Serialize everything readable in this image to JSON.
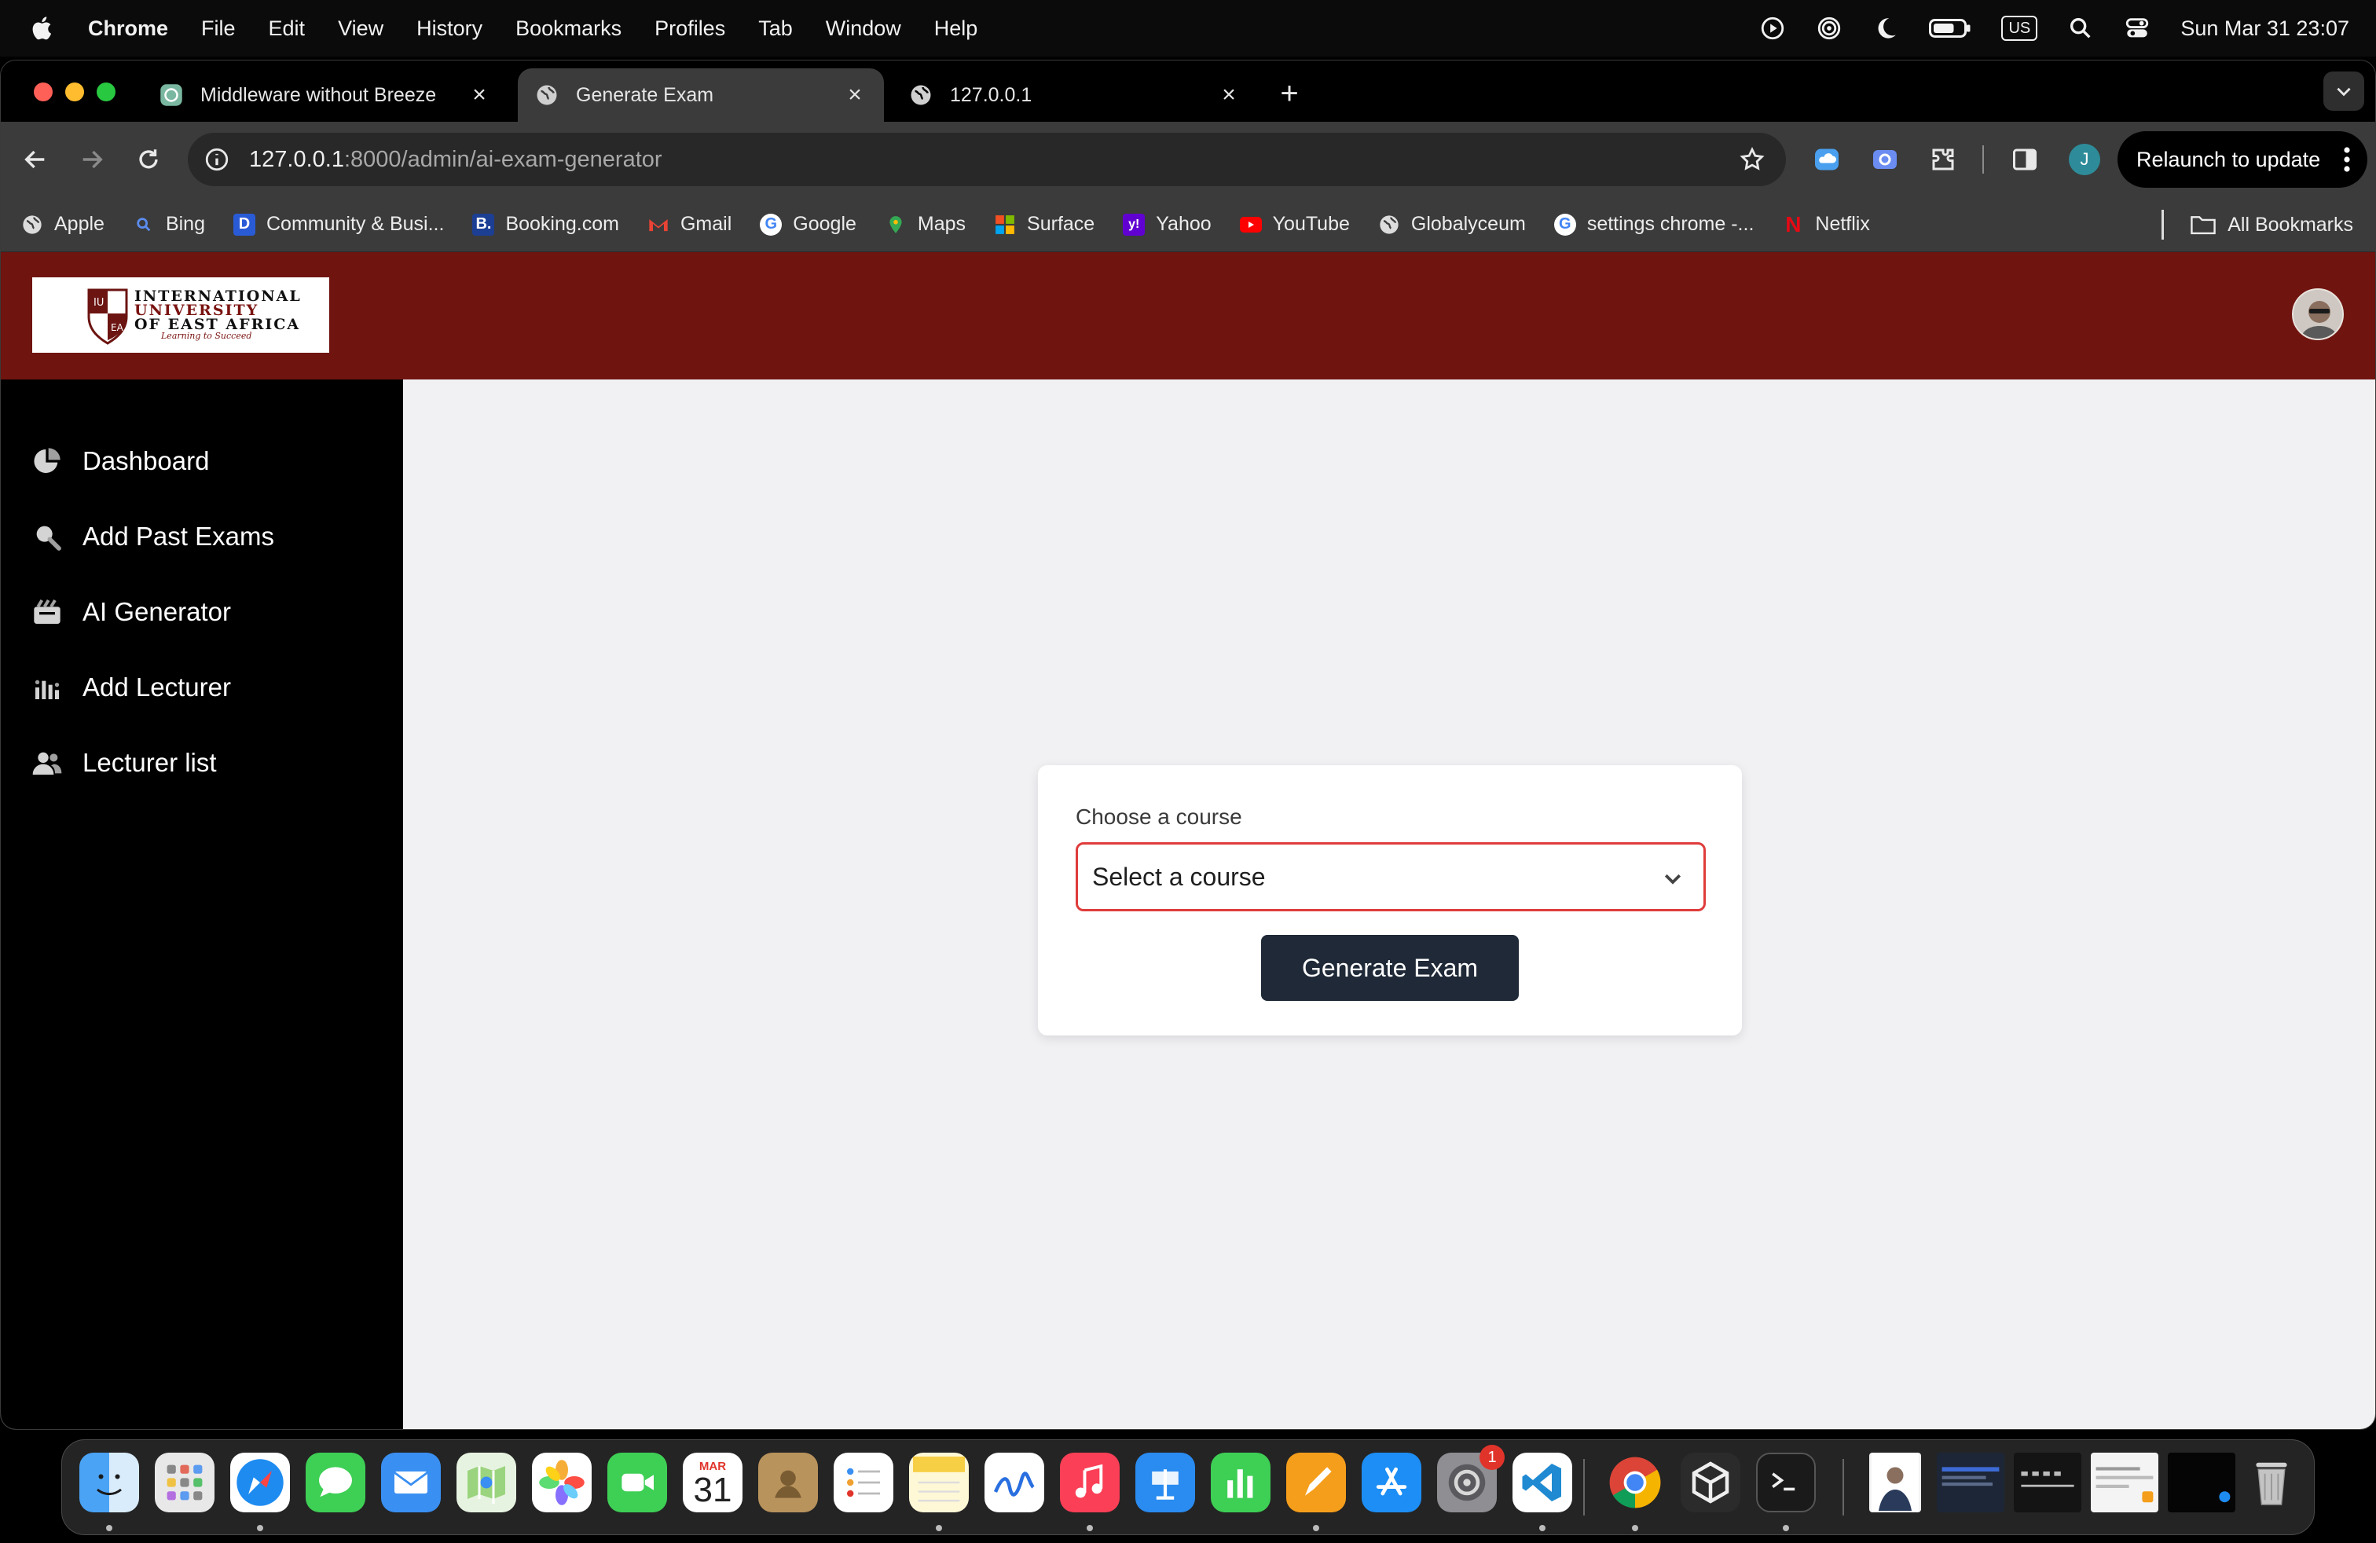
{
  "menubar": {
    "app": "Chrome",
    "items": [
      "File",
      "Edit",
      "View",
      "History",
      "Bookmarks",
      "Profiles",
      "Tab",
      "Window",
      "Help"
    ],
    "keyboard": "US",
    "datetime": "Sun Mar 31  23:07"
  },
  "tabs": [
    {
      "title": "Middleware without Breeze",
      "active": false
    },
    {
      "title": "Generate Exam",
      "active": true
    },
    {
      "title": "127.0.0.1",
      "active": false
    }
  ],
  "omnibox": {
    "host": "127.0.0.1",
    "path": ":8000/admin/ai-exam-generator"
  },
  "profile_initial": "J",
  "relaunch_label": "Relaunch to update",
  "bookmarks": [
    {
      "label": "Apple",
      "icon": "globe-icon"
    },
    {
      "label": "Bing",
      "icon": "search-icon"
    },
    {
      "label": "Community & Busi...",
      "icon": "community-icon"
    },
    {
      "label": "Booking.com",
      "icon": "booking-icon"
    },
    {
      "label": "Gmail",
      "icon": "gmail-icon"
    },
    {
      "label": "Google",
      "icon": "google-icon"
    },
    {
      "label": "Maps",
      "icon": "maps-icon"
    },
    {
      "label": "Surface",
      "icon": "microsoft-icon"
    },
    {
      "label": "Yahoo",
      "icon": "yahoo-icon"
    },
    {
      "label": "YouTube",
      "icon": "youtube-icon"
    },
    {
      "label": "Globalyceum",
      "icon": "globe-icon"
    },
    {
      "label": "settings chrome -...",
      "icon": "google-icon"
    },
    {
      "label": "Netflix",
      "icon": "netflix-icon"
    }
  ],
  "all_bookmarks": "All Bookmarks",
  "site": {
    "logo": {
      "line1": "INTERNATIONAL",
      "line2": "UNIVERSITY",
      "line3": "OF EAST AFRICA",
      "tagline": "Learning to Succeed"
    },
    "brand_color": "#701410",
    "sidebar": [
      {
        "label": "Dashboard",
        "icon": "chart-pie-icon"
      },
      {
        "label": "Add Past Exams",
        "icon": "search-icon"
      },
      {
        "label": "AI Generator",
        "icon": "ai-generator-icon"
      },
      {
        "label": "Add Lecturer",
        "icon": "bar-chart-icon"
      },
      {
        "label": "Lecturer list",
        "icon": "users-icon"
      }
    ],
    "form": {
      "label": "Choose a course",
      "select_value": "Select a course",
      "button": "Generate Exam"
    }
  },
  "dock": {
    "calendar_month": "MAR",
    "calendar_day": "31",
    "settings_badge": "1"
  }
}
